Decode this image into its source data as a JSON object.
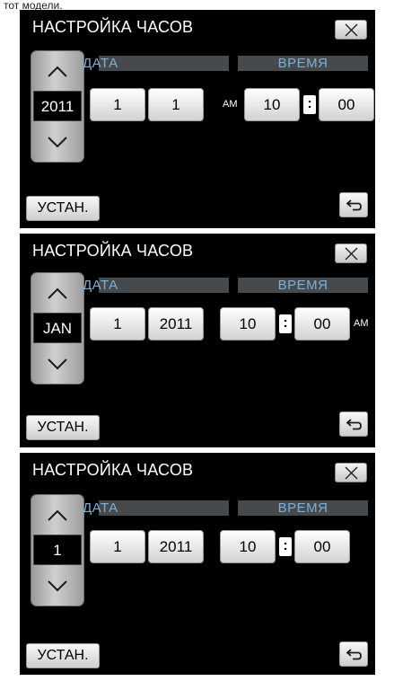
{
  "caption": "тот модели.",
  "screens": [
    {
      "title": "НАСТРОЙКА ЧАСОВ",
      "scroll_value": "2011",
      "date_label": "ДАТА",
      "time_label": "ВРЕМЯ",
      "date_fields": [
        "1",
        "1"
      ],
      "ampm": "AM",
      "hour": "10",
      "colon": ":",
      "minute": "00",
      "set_label": "УСТАН."
    },
    {
      "title": "НАСТРОЙКА ЧАСОВ",
      "scroll_value": "JAN",
      "date_label": "ДАТА",
      "time_label": "ВРЕМЯ",
      "date_fields": [
        "1",
        "2011"
      ],
      "hour": "10",
      "colon": ":",
      "minute": "00",
      "ampm": "AM",
      "set_label": "УСТАН."
    },
    {
      "title": "НАСТРОЙКА ЧАСОВ",
      "scroll_value": "1",
      "date_label": "ДАТА",
      "time_label": "ВРЕМЯ",
      "date_fields": [
        "1",
        "2011"
      ],
      "hour": "10",
      "colon": ":",
      "minute": "00",
      "set_label": "УСТАН."
    }
  ],
  "colors": {
    "screen_bg": "#000000",
    "header_bar": "#474a4d",
    "header_text": "#7ab0d8"
  },
  "icons": [
    "close-icon",
    "chevron-up-icon",
    "chevron-down-icon",
    "return-arrow-icon"
  ]
}
